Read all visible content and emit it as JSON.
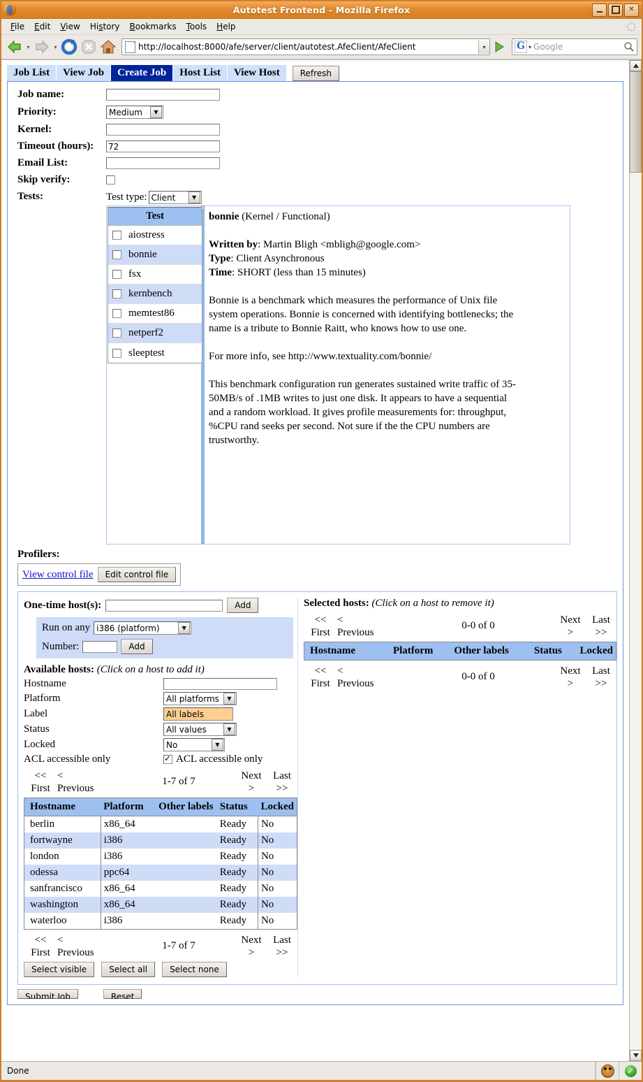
{
  "window": {
    "title": "Autotest Frontend - Mozilla Firefox",
    "minimize_label": "_",
    "maximize_label": "□",
    "close_label": "✕"
  },
  "menubar": {
    "items": [
      "File",
      "Edit",
      "View",
      "History",
      "Bookmarks",
      "Tools",
      "Help"
    ]
  },
  "toolbar": {
    "back": "back-arrow",
    "forward": "forward-arrow",
    "reload": "reload-icon",
    "stop": "stop-icon",
    "home": "home-icon",
    "url": "http://localhost:8000/afe/server/client/autotest.AfeClient/AfeClient",
    "go": "go-arrow",
    "search_engine": "G",
    "search_placeholder": "Google"
  },
  "statusbar": {
    "text": "Done",
    "icons": [
      "monkey-icon",
      "green-check-icon"
    ]
  },
  "app": {
    "tabs": [
      {
        "label": "Job List",
        "active": false
      },
      {
        "label": "View Job",
        "active": false
      },
      {
        "label": "Create Job",
        "active": true
      },
      {
        "label": "Host List",
        "active": false
      },
      {
        "label": "View Host",
        "active": false
      }
    ],
    "refresh_label": "Refresh",
    "form": {
      "job_name_label": "Job name:",
      "job_name_value": "",
      "priority_label": "Priority:",
      "priority_value": "Medium",
      "kernel_label": "Kernel:",
      "kernel_value": "",
      "timeout_label": "Timeout (hours):",
      "timeout_value": "72",
      "email_label": "Email List:",
      "email_value": "",
      "skip_verify_label": "Skip verify:",
      "skip_verify_checked": false,
      "tests_label": "Tests:",
      "test_type_label": "Test type:",
      "test_type_value": "Client"
    },
    "tests": {
      "header": "Test",
      "rows": [
        {
          "name": "aiostress",
          "checked": false
        },
        {
          "name": "bonnie",
          "checked": false
        },
        {
          "name": "fsx",
          "checked": false
        },
        {
          "name": "kernbench",
          "checked": false
        },
        {
          "name": "memtest86",
          "checked": false
        },
        {
          "name": "netperf2",
          "checked": false
        },
        {
          "name": "sleeptest",
          "checked": false
        }
      ]
    },
    "test_detail": {
      "name": "bonnie",
      "category": "(Kernel / Functional)",
      "written_by_label": "Written by",
      "written_by_value": ": Martin Bligh <mbligh@google.com>",
      "type_label": "Type",
      "type_value": ": Client Asynchronous",
      "time_label": "Time",
      "time_value": ": SHORT (less than 15 minutes)",
      "paragraph1": "Bonnie is a benchmark which measures the performance of Unix file system operations. Bonnie is concerned with identifying bottlenecks; the name is a tribute to Bonnie Raitt, who knows how to use one.",
      "paragraph2": "For more info, see http://www.textuality.com/bonnie/",
      "paragraph3": "This benchmark configuration run generates sustained write traffic of 35-50MB/s of .1MB writes to just one disk. It appears to have a sequential and a random workload. It gives profile measurements for: throughput, %CPU rand seeks per second. Not sure if the the CPU numbers are trustworthy."
    },
    "profilers": {
      "label": "Profilers:",
      "view_control_file": "View control file",
      "edit_control_file": "Edit control file"
    },
    "hosts": {
      "one_time_label": "One-time host(s):",
      "one_time_value": "",
      "one_time_add": "Add",
      "run_on_any_label": "Run on any",
      "run_on_any_value": "i386 (platform)",
      "number_label": "Number:",
      "number_value": "",
      "number_add": "Add",
      "available_label": "Available hosts:",
      "available_hint": "(Click on a host to add it)",
      "filters": [
        {
          "label": "Hostname",
          "type": "input",
          "value": ""
        },
        {
          "label": "Platform",
          "type": "select",
          "value": "All platforms"
        },
        {
          "label": "Label",
          "type": "listbox",
          "value": "All labels"
        },
        {
          "label": "Status",
          "type": "select",
          "value": "All values"
        },
        {
          "label": "Locked",
          "type": "select",
          "value": "No"
        },
        {
          "label": "ACL accessible only",
          "type": "checkbox",
          "value": "ACL accessible only",
          "checked": true
        }
      ],
      "pager": {
        "first": "<<\nFirst",
        "first_l1": "<<",
        "first_l2": "First",
        "prev_l1": "<",
        "prev_l2": "Previous",
        "next_l1": "Next",
        "next_l2": ">",
        "last_l1": "Last",
        "last_l2": ">>",
        "count_available": "1-7 of 7",
        "count_selected": "0-0 of 0"
      },
      "columns": [
        "Hostname",
        "Platform",
        "Other labels",
        "Status",
        "Locked"
      ],
      "rows": [
        {
          "hostname": "berlin",
          "platform": "x86_64",
          "other_labels": "",
          "status": "Ready",
          "locked": "No"
        },
        {
          "hostname": "fortwayne",
          "platform": "i386",
          "other_labels": "",
          "status": "Ready",
          "locked": "No"
        },
        {
          "hostname": "london",
          "platform": "i386",
          "other_labels": "",
          "status": "Ready",
          "locked": "No"
        },
        {
          "hostname": "odessa",
          "platform": "ppc64",
          "other_labels": "",
          "status": "Ready",
          "locked": "No"
        },
        {
          "hostname": "sanfrancisco",
          "platform": "x86_64",
          "other_labels": "",
          "status": "Ready",
          "locked": "No"
        },
        {
          "hostname": "washington",
          "platform": "x86_64",
          "other_labels": "",
          "status": "Ready",
          "locked": "No"
        },
        {
          "hostname": "waterloo",
          "platform": "i386",
          "other_labels": "",
          "status": "Ready",
          "locked": "No"
        }
      ],
      "select_visible": "Select visible",
      "select_all": "Select all",
      "select_none": "Select none",
      "selected_label": "Selected hosts:",
      "selected_hint": "(Click on a host to remove it)",
      "selected_rows": []
    },
    "submit": {
      "submit_label": "Submit Job",
      "reset_label": "Reset"
    }
  }
}
